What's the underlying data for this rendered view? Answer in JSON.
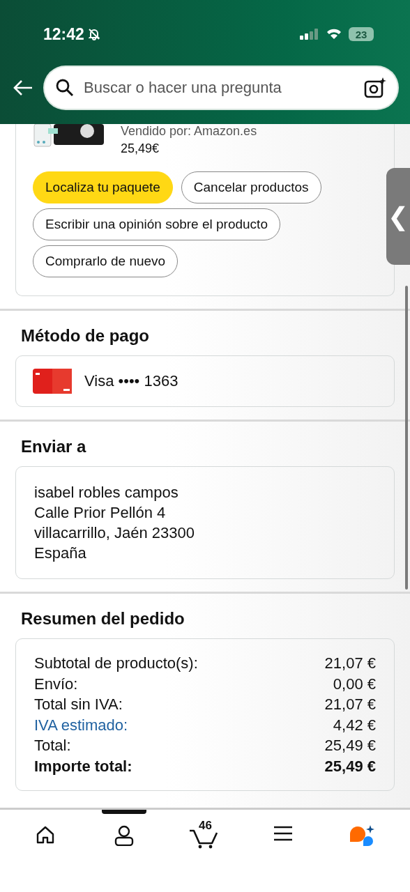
{
  "status_bar": {
    "time": "12:42",
    "battery": "23"
  },
  "search": {
    "placeholder": "Buscar o hacer una pregunta"
  },
  "product": {
    "seller": "Vendido por: Amazon.es",
    "price": "25,49€"
  },
  "actions": [
    {
      "label": "Localiza tu paquete",
      "kind": "primary"
    },
    {
      "label": "Cancelar productos",
      "kind": "secondary"
    },
    {
      "label": "Escribir una opinión sobre el producto",
      "kind": "secondary"
    },
    {
      "label": "Comprarlo de nuevo",
      "kind": "secondary"
    }
  ],
  "side_handle": {
    "glyph": "❮"
  },
  "payment": {
    "title": "Método de pago",
    "card": "Visa •••• 1363"
  },
  "shipping": {
    "title": "Enviar a",
    "lines": [
      "isabel robles campos",
      "Calle Prior Pellón 4",
      "villacarrillo, Jaén 23300",
      "España"
    ]
  },
  "summary": {
    "title": "Resumen del pedido",
    "rows": [
      {
        "label": "Subtotal de producto(s):",
        "value": "21,07 €",
        "kind": "normal"
      },
      {
        "label": "Envío:",
        "value": "0,00 €",
        "kind": "normal"
      },
      {
        "label": "Total sin IVA:",
        "value": "21,07 €",
        "kind": "normal"
      },
      {
        "label": "IVA estimado:",
        "value": "4,42 €",
        "kind": "link"
      },
      {
        "label": "Total:",
        "value": "25,49 €",
        "kind": "normal"
      },
      {
        "label": "Importe total:",
        "value": "25,49 €",
        "kind": "total"
      }
    ]
  },
  "nav": [
    {
      "kind": "home",
      "selected": false
    },
    {
      "kind": "account",
      "selected": true
    },
    {
      "kind": "cart",
      "count": "46",
      "selected": false
    },
    {
      "kind": "menu",
      "selected": false
    },
    {
      "kind": "assistant",
      "selected": false
    }
  ]
}
